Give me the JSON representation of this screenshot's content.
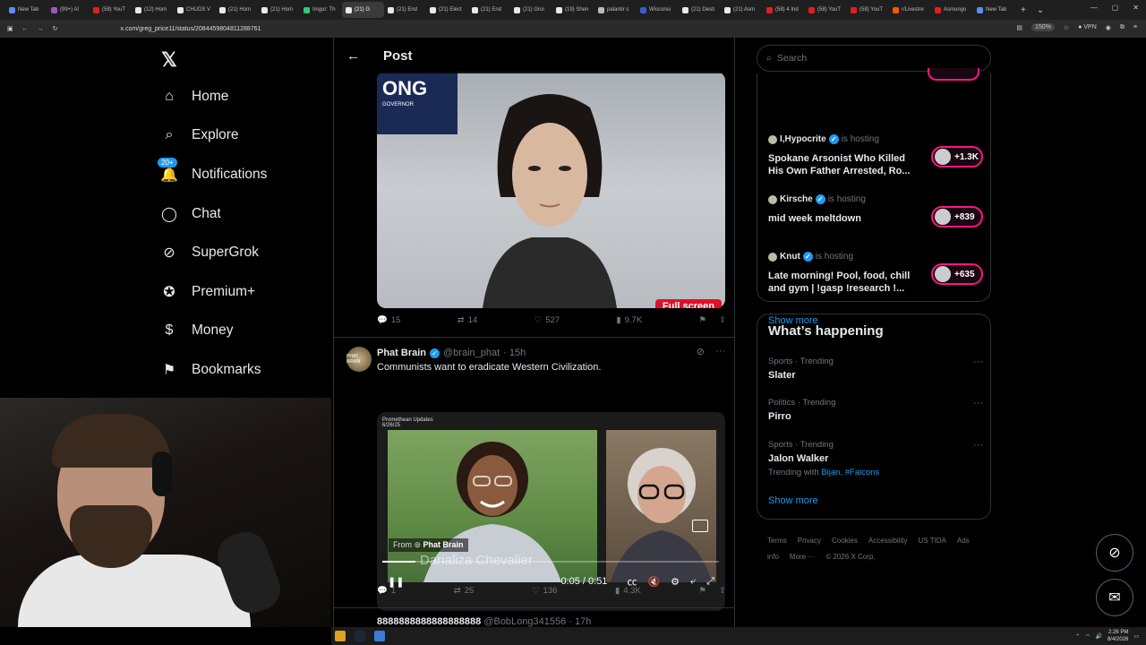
{
  "browser": {
    "tabs": [
      {
        "label": "New Tab",
        "color": "#5b8def"
      },
      {
        "label": "(99+) Al",
        "color": "#9b59b6"
      },
      {
        "label": "(58) YouT",
        "color": "#e02020"
      },
      {
        "label": "(12) Hom",
        "color": "#e7e9ea"
      },
      {
        "label": "CHUDS V",
        "color": "#e7e9ea"
      },
      {
        "label": "(21) Hom",
        "color": "#e7e9ea"
      },
      {
        "label": "(21) Hom",
        "color": "#e7e9ea"
      },
      {
        "label": "Imgur: Th",
        "color": "#2ecc71"
      },
      {
        "label": "(21) G",
        "color": "#e7e9ea",
        "active": true
      },
      {
        "label": "(21) End",
        "color": "#e7e9ea"
      },
      {
        "label": "(21) Elect",
        "color": "#e7e9ea"
      },
      {
        "label": "(21) End",
        "color": "#e7e9ea"
      },
      {
        "label": "(21) Groi",
        "color": "#e7e9ea"
      },
      {
        "label": "(19) Shen",
        "color": "#e7e9ea"
      },
      {
        "label": "palantir s",
        "color": "#bbbbbb"
      },
      {
        "label": "Wisconsi",
        "color": "#3b5bdb"
      },
      {
        "label": "(21) Desti",
        "color": "#e7e9ea"
      },
      {
        "label": "(21) Asm",
        "color": "#e7e9ea"
      },
      {
        "label": "(58) 4 Ind",
        "color": "#e02020"
      },
      {
        "label": "(58) YouT",
        "color": "#e02020"
      },
      {
        "label": "(58) YouT",
        "color": "#e02020"
      },
      {
        "label": "r/Livestre",
        "color": "#ff5700"
      },
      {
        "label": "Asmongo",
        "color": "#e02020"
      },
      {
        "label": "New Tab",
        "color": "#5b8def"
      }
    ],
    "url": "x.com/greg_price11/status/2084459804811288761",
    "zoom": "150%",
    "vpn": "VPN"
  },
  "nav": {
    "items": [
      {
        "label": "Home",
        "icon": "home-icon",
        "glyph": "⌂"
      },
      {
        "label": "Explore",
        "icon": "search-icon",
        "glyph": "⌕"
      },
      {
        "label": "Notifications",
        "icon": "bell-icon",
        "glyph": "🔔",
        "badge": "20+"
      },
      {
        "label": "Chat",
        "icon": "chat-bubble-icon",
        "glyph": "◯"
      },
      {
        "label": "SuperGrok",
        "icon": "grok-icon",
        "glyph": "⊘"
      },
      {
        "label": "Premium+",
        "icon": "verified-badge-icon",
        "glyph": "✪"
      },
      {
        "label": "Money",
        "icon": "money-icon",
        "glyph": "$"
      },
      {
        "label": "Bookmarks",
        "icon": "bookmark-icon",
        "glyph": "⚑"
      }
    ]
  },
  "post": {
    "header_title": "Post",
    "video1": {
      "sign_text": "ONG",
      "sign_sub": "GOVERNOR",
      "overlay_label": "Full screen"
    },
    "actions1": {
      "replies": "15",
      "reposts": "14",
      "likes": "527",
      "views": "9.7K"
    },
    "tweet2": {
      "name": "Phat Brain",
      "handle": "@brain_phat",
      "time": "· 15h",
      "text": "Communists want to eradicate Western Civilization.",
      "video_source": "Promethean Updates",
      "video_date": "6/26/25",
      "from_label": "From",
      "from_name": "Phat Brain",
      "caption": "Darializa Chevalier",
      "time_display": "0:05 / 0:51",
      "progress": 0.098
    },
    "actions2": {
      "replies": "1",
      "reposts": "25",
      "likes": "136",
      "views": "4.3K"
    },
    "tweet3": {
      "name": "8888888888888888888",
      "handle": "@BobLong341556 · 17h"
    }
  },
  "search": {
    "placeholder": "Search"
  },
  "spaces": {
    "items": [
      {
        "host": "I,Hypocrite",
        "is_hosting": "is hosting",
        "title": "Spokane Arsonist Who Killed His Own Father Arrested, Ro...",
        "count": "+1.3K"
      },
      {
        "host": "Kirsche",
        "is_hosting": "is hosting",
        "title": "mid week meltdown",
        "count": "+839"
      },
      {
        "host": "Knut",
        "is_hosting": "is hosting",
        "title": "Late morning! Pool, food, chill and gym | !gasp !research !...",
        "count": "+635"
      }
    ],
    "show_more": "Show more"
  },
  "happening": {
    "title": "What’s happening",
    "trends": [
      {
        "meta": "Sports · Trending",
        "name": "Slater"
      },
      {
        "meta": "Politics · Trending",
        "name": "Pirro"
      },
      {
        "meta": "Sports · Trending",
        "name": "Jalon Walker",
        "with_label": "Trending with",
        "with_links": "Bijan, #Falcons"
      }
    ],
    "show_more": "Show more"
  },
  "footer": {
    "links": [
      "Terms",
      "Privacy",
      "Cookies",
      "Accessibility",
      "US TIDA",
      "Ads info",
      "More ···",
      "© 2026 X Corp."
    ]
  },
  "taskbar": {
    "time": "2:26 PM",
    "date": "8/4/2026"
  },
  "colors": {
    "accent": "#1d9bf0",
    "live": "#f91880",
    "bg": "#000000",
    "border": "#2f3336"
  }
}
